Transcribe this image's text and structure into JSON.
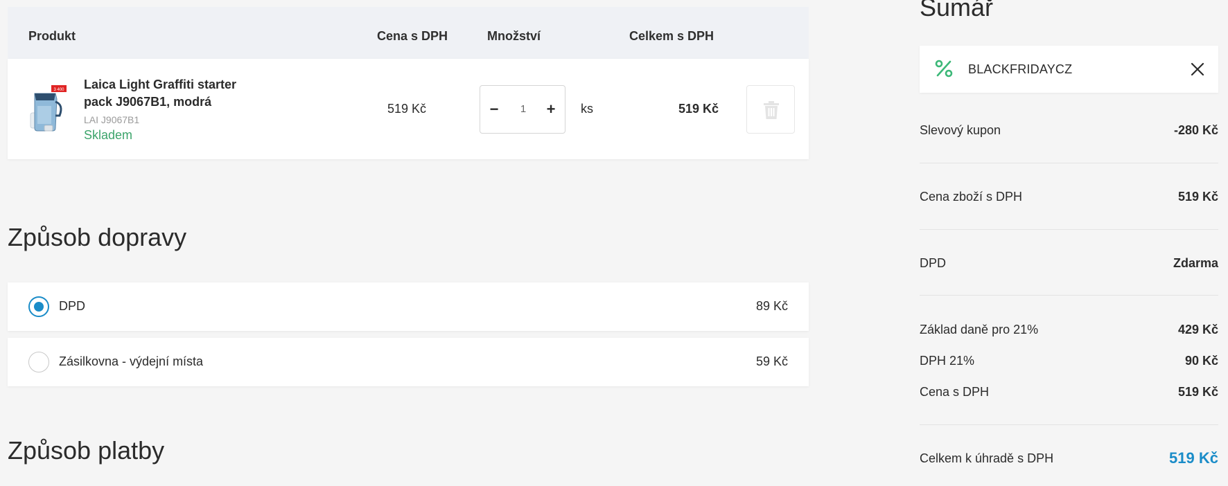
{
  "cart": {
    "headers": {
      "product": "Produkt",
      "price": "Cena s DPH",
      "quantity": "Množství",
      "total": "Celkem s DPH"
    },
    "item": {
      "name": "Laica Light Graffiti starter pack J9067B1, modrá",
      "code": "LAI J9067B1",
      "stock": "Skladem",
      "price": "519 Kč",
      "quantity": "1",
      "unit": "ks",
      "total": "519 Kč",
      "thumb_badge": "3 400"
    },
    "stepper": {
      "minus": "−",
      "plus": "+"
    }
  },
  "shipping": {
    "title": "Způsob dopravy",
    "options": [
      {
        "label": "DPD",
        "price": "89 Kč",
        "selected": true
      },
      {
        "label": "Zásilkovna - výdejní místa",
        "price": "59 Kč",
        "selected": false
      }
    ]
  },
  "payment": {
    "title": "Způsob platby"
  },
  "summary": {
    "title": "Sumář",
    "coupon_code": "BLACKFRIDAYCZ",
    "rows": [
      {
        "label": "Slevový kupon",
        "value": "-280 Kč"
      },
      {
        "label": "Cena zboží s DPH",
        "value": "519 Kč"
      },
      {
        "label": "DPD",
        "value": "Zdarma"
      },
      {
        "label": "Základ daně pro 21%",
        "value": "429 Kč"
      },
      {
        "label": "DPH 21%",
        "value": "90 Kč"
      },
      {
        "label": "Cena s DPH",
        "value": "519 Kč"
      },
      {
        "label": "Celkem k úhradě s DPH",
        "value": "519 Kč"
      }
    ]
  },
  "colors": {
    "accent": "#1a8cc8",
    "stock_green": "#3ca46b",
    "coupon_icon": "#3cb878"
  },
  "icons": {
    "percent": "percent-icon",
    "close": "close-icon",
    "trash": "trash-icon"
  }
}
